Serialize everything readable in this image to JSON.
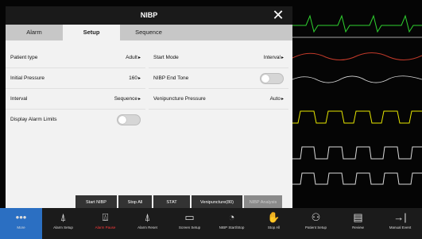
{
  "dialog": {
    "title": "NIBP",
    "close_glyph": "✕"
  },
  "tabs": [
    {
      "label": "Alarm"
    },
    {
      "label": "Setup"
    },
    {
      "label": "Sequence"
    }
  ],
  "setup": {
    "patient_type": {
      "label": "Patient type",
      "value": "Adult"
    },
    "start_mode": {
      "label": "Start Mode",
      "value": "Interval"
    },
    "initial_pressure": {
      "label": "Initial Pressure",
      "value": "160"
    },
    "end_tone": {
      "label": "NIBP End Tone",
      "on": false
    },
    "interval": {
      "label": "Interval",
      "value": "Sequence"
    },
    "venipuncture_pressure": {
      "label": "Venipuncture Pressure",
      "value": "Auto"
    },
    "display_alarm_limits": {
      "label": "Display Alarm Limits",
      "on": false
    }
  },
  "actions": {
    "start_nibp": "Start NIBP",
    "stop_all": "Stop All",
    "stat": "STAT",
    "venipuncture": "Venipuncture(80)",
    "nibp_analysis": "NIBP Analysis"
  },
  "toolbar": [
    {
      "label": "More",
      "icon": "more-icon",
      "glyph": "•••"
    },
    {
      "label": "Alarm Setup",
      "icon": "alarm-setup-icon",
      "glyph": "⍋"
    },
    {
      "label": "Alarm Pause",
      "icon": "alarm-pause-icon",
      "glyph": "⍍"
    },
    {
      "label": "Alarm Reset",
      "icon": "alarm-reset-icon",
      "glyph": "⍋"
    },
    {
      "label": "Screen Setup",
      "icon": "screen-setup-icon",
      "glyph": "▭"
    },
    {
      "label": "NIBP Start/Stop",
      "icon": "nibp-icon",
      "glyph": "◔"
    },
    {
      "label": "Stop All",
      "icon": "stop-all-icon",
      "glyph": "✋"
    },
    {
      "label": "Patient Setup",
      "icon": "patient-setup-icon",
      "glyph": "⚇"
    },
    {
      "label": "Review",
      "icon": "review-icon",
      "glyph": "▤"
    },
    {
      "label": "Manual Event",
      "icon": "manual-event-icon",
      "glyph": "→|"
    },
    {
      "label": "",
      "icon": "arrow-icon",
      "glyph": "→"
    }
  ],
  "colors": {
    "active_tab_bg": "#f2f2f2",
    "toolbar_active": "#2b6fc2",
    "alarm_pause_label": "#ff3b3b",
    "wave_green": "#2fd12f",
    "wave_white": "#d9d9d9",
    "wave_yellow": "#e6e600",
    "wave_red": "#c23a2a",
    "wave_cyan": "#2fc7d9"
  }
}
